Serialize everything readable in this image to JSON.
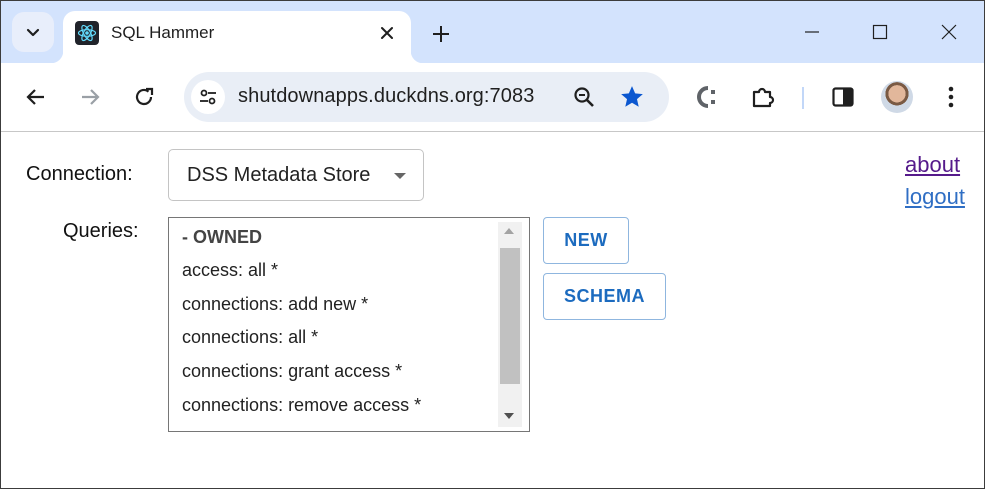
{
  "browser": {
    "tab_title": "SQL Hammer",
    "url": "shutdownapps.duckdns.org:7083",
    "icons": {
      "tab_search": "chevron-down-icon",
      "tab_favicon": "react-icon",
      "tab_close": "close-icon",
      "new_tab": "plus-icon",
      "minimize": "minimize-icon",
      "maximize": "maximize-icon",
      "close_window": "close-icon",
      "back": "arrow-left-icon",
      "forward": "arrow-right-icon",
      "reload": "reload-icon",
      "site_info": "tune-icon",
      "zoom": "zoom-icon",
      "bookmark": "star-icon",
      "extension_c": "extension-icon",
      "extensions": "puzzle-icon",
      "side_panel": "side-panel-icon",
      "profile": "avatar",
      "menu": "more-vert-icon"
    },
    "colors": {
      "titlebar": "#d3e3fd",
      "omnibox": "#e9eef6",
      "star": "#0b57d0"
    }
  },
  "page": {
    "connection_label": "Connection:",
    "connection_value": "DSS Metadata Store",
    "queries_label": "Queries:",
    "queries": [
      {
        "text": "- OWNED",
        "group": true
      },
      {
        "text": "access: all *",
        "group": false
      },
      {
        "text": "connections: add new *",
        "group": false
      },
      {
        "text": "connections: all *",
        "group": false
      },
      {
        "text": "connections: grant access *",
        "group": false
      },
      {
        "text": "connections: remove access *",
        "group": false
      }
    ],
    "buttons": {
      "new": "NEW",
      "schema": "SCHEMA"
    },
    "links": {
      "about": "about",
      "logout": "logout"
    },
    "colors": {
      "button_text": "#1c6bbf",
      "link_visited": "#551a8b",
      "link": "#2f6ec4"
    }
  }
}
